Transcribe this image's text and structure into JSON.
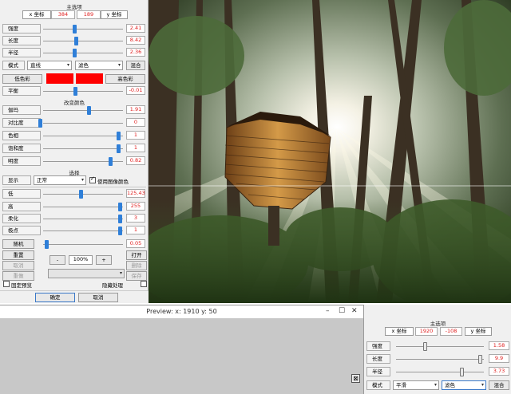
{
  "left": {
    "main_title": "主选项",
    "x_tab": "x 坐标",
    "x_val": "384",
    "y_val": "189",
    "y_tab": "y 坐标",
    "rows": [
      {
        "label": "强度",
        "value": "2.41",
        "pos": 0.78
      },
      {
        "label": "长度",
        "value": "8.42",
        "pos": 0.8
      },
      {
        "label": "半径",
        "value": "2.36",
        "pos": 0.78
      }
    ],
    "mode_label": "模式",
    "mode_select": "直线",
    "blend_select": "滤色",
    "blend_btn": "混合",
    "low_color": "低色彩",
    "high_color": "高色彩",
    "color_swatch": "#ff0000",
    "balance_label": "平衡",
    "balance_value": "-0.01",
    "balance_pos": 0.5,
    "change_color_title": "改变颜色",
    "color_rows": [
      {
        "label": "伽玛",
        "value": "1.91",
        "pos": 0.6
      },
      {
        "label": "对比度",
        "value": "0",
        "pos": 0.0
      },
      {
        "label": "色相",
        "value": "1",
        "pos": 1.0
      },
      {
        "label": "饱和度",
        "value": "1",
        "pos": 1.0
      },
      {
        "label": "明度",
        "value": "0.82",
        "pos": 0.9
      }
    ],
    "select_title": "选择",
    "display_label": "显示",
    "display_select": "正常",
    "use_image_color": "使用图像颜色",
    "select_rows": [
      {
        "label": "低",
        "value": "125.43",
        "pos": 0.5
      },
      {
        "label": "高",
        "value": "255",
        "pos": 1.0
      },
      {
        "label": "柔化",
        "value": "3",
        "pos": 1.0
      },
      {
        "label": "极点",
        "value": "1",
        "pos": 1.0
      }
    ],
    "random_label": "随机",
    "random_value": "0.05",
    "random_pos": 0.05,
    "reset_btn": "重置",
    "cancel_gray_btn": "取消",
    "redo_btn": "重做",
    "minus_btn": "-",
    "zoom": "100%",
    "plus_btn": "+",
    "open_btn": "打开",
    "delete_btn": "删除",
    "save_btn": "保存",
    "fixed_preview": "固定预览",
    "hide_processing": "隐藏处理",
    "ok_btn": "确定",
    "cancel_btn": "取消"
  },
  "preview": {
    "title": "Preview:  x: 1910  y: 50"
  },
  "right": {
    "main_title": "主选项",
    "x_tab": "x 坐标",
    "x_val": "1920",
    "y_val": "-108",
    "y_tab": "y 坐标",
    "rows": [
      {
        "label": "强度",
        "value": "1.58",
        "pos": 0.3
      },
      {
        "label": "长度",
        "value": "9.9",
        "pos": 0.95
      },
      {
        "label": "半径",
        "value": "3.73",
        "pos": 0.75
      }
    ],
    "mode_label": "模式",
    "mode_select": "平滑",
    "blend_select": "滤色",
    "blend_btn": "混合"
  }
}
